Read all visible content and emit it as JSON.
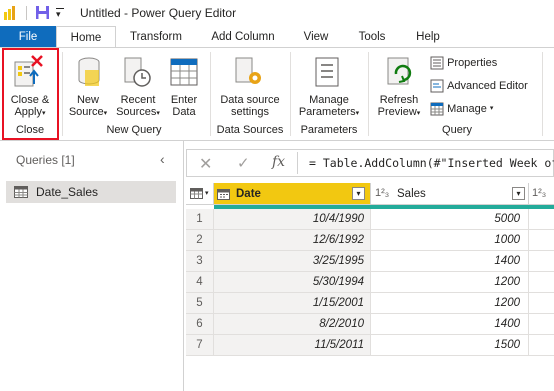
{
  "titlebar": {
    "title": "Untitled - Power Query Editor",
    "qat_caret": "▾"
  },
  "tabs": [
    "File",
    "Home",
    "Transform",
    "Add Column",
    "View",
    "Tools",
    "Help"
  ],
  "ribbon": {
    "close_apply": {
      "line1": "Close &",
      "line2": "Apply",
      "caret": "▾"
    },
    "new_source": {
      "line1": "New",
      "line2": "Source",
      "caret": "▾"
    },
    "recent_sources": {
      "line1": "Recent",
      "line2": "Sources",
      "caret": "▾"
    },
    "enter_data": {
      "line1": "Enter",
      "line2": "Data"
    },
    "data_source_settings": {
      "line1": "Data source",
      "line2": "settings"
    },
    "manage_parameters": {
      "line1": "Manage",
      "line2": "Parameters",
      "caret": "▾"
    },
    "refresh_preview": {
      "line1": "Refresh",
      "line2": "Preview",
      "caret": "▾"
    },
    "properties": "Properties",
    "advanced_editor": "Advanced Editor",
    "manage": "Manage",
    "manage_caret": "▾",
    "groups": {
      "close": "Close",
      "new_query": "New Query",
      "data_sources": "Data Sources",
      "parameters": "Parameters",
      "query": "Query"
    }
  },
  "queries_pane": {
    "header": "Queries [1]",
    "collapse_glyph": "‹",
    "items": [
      {
        "label": "Date_Sales"
      }
    ]
  },
  "formula_bar": {
    "cancel_glyph": "✕",
    "commit_glyph": "✓",
    "fx_glyph": "fx",
    "formula": "= Table.AddColumn(#\"Inserted Week of M"
  },
  "grid": {
    "table_icon_caret": "▾",
    "columns": [
      {
        "name": "Date",
        "type_icon": "calendar-icon",
        "dropdown": "▾"
      },
      {
        "name": "Sales",
        "type_icon": "1²₃",
        "dropdown": "▾"
      },
      {
        "name": "",
        "type_icon": "1²₃"
      }
    ],
    "rows": [
      {
        "n": "1",
        "date": "10/4/1990",
        "sales": "5000"
      },
      {
        "n": "2",
        "date": "12/6/1992",
        "sales": "1000"
      },
      {
        "n": "3",
        "date": "3/25/1995",
        "sales": "1400"
      },
      {
        "n": "4",
        "date": "5/30/1994",
        "sales": "1200"
      },
      {
        "n": "5",
        "date": "1/15/2001",
        "sales": "1200"
      },
      {
        "n": "6",
        "date": "8/2/2010",
        "sales": "1400"
      },
      {
        "n": "7",
        "date": "11/5/2011",
        "sales": "1500"
      }
    ]
  },
  "colors": {
    "accent": "#0f6cbd",
    "highlight_header": "#f2c811",
    "quality_bar": "#23ab9a",
    "close_frame": "#e81123"
  }
}
